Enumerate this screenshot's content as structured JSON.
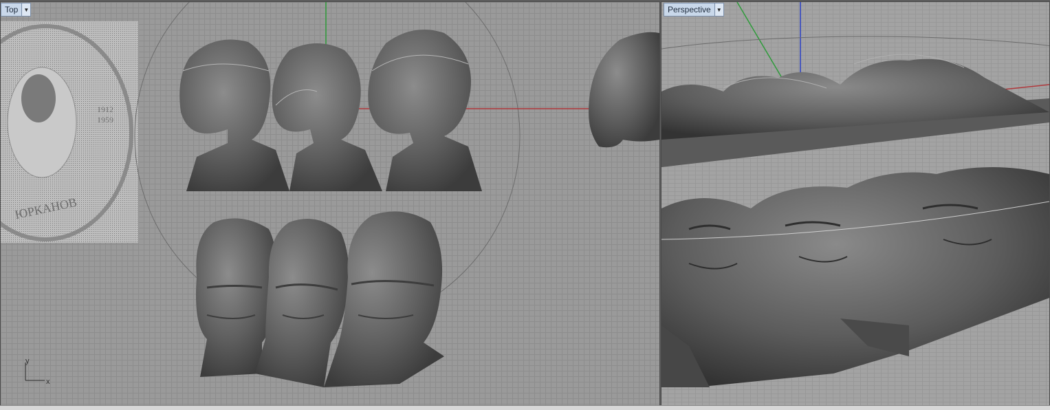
{
  "viewports": {
    "top": {
      "label": "Top",
      "dropdown_icon": "caret-down-icon"
    },
    "perspective": {
      "label": "Perspective",
      "dropdown_icon": "caret-down-icon"
    }
  },
  "axes": {
    "y_label": "y",
    "x_label": "x"
  },
  "colors": {
    "viewport_bg": "#9a9a9a",
    "grid_line": "#8d8d8d",
    "x_axis": "#b0363a",
    "y_axis": "#2e9b3a",
    "z_axis": "#2a3fc4",
    "model": "#5f5f5f",
    "tab_bg": "#c9d8ea"
  },
  "reference_image": {
    "text_left": "ЮРКАНОВ",
    "text_years_top": "1912",
    "text_years_bottom": "1959"
  }
}
